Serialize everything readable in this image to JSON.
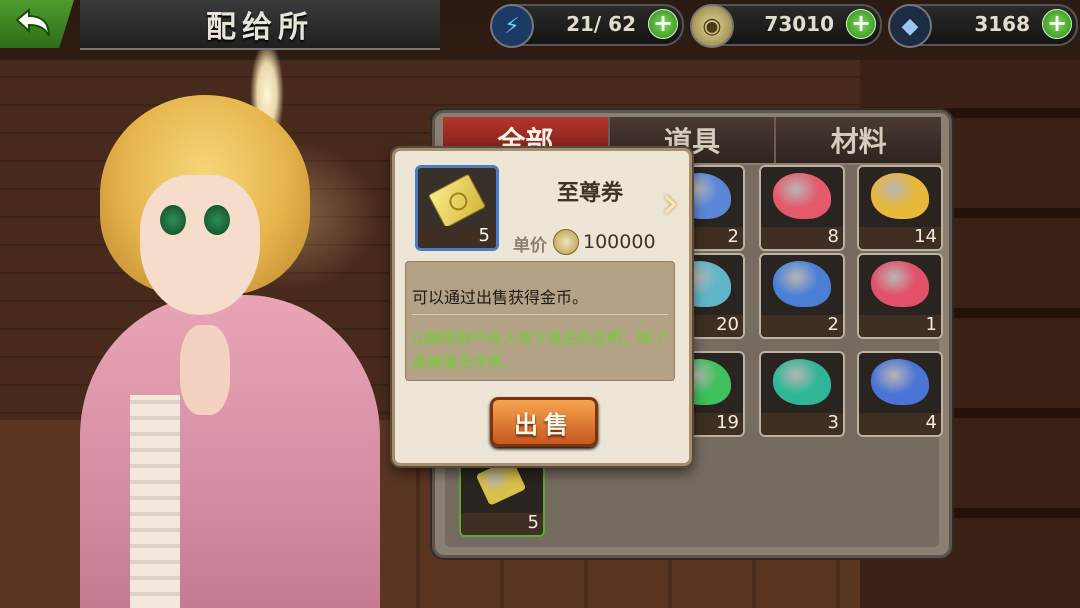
{
  "header": {
    "title": "配给所",
    "stamina": {
      "icon": "lightning-icon",
      "value": "21/ 62"
    },
    "gold": {
      "icon": "coin-icon",
      "value": "73010"
    },
    "gems": {
      "icon": "crystal-icon",
      "value": "3168"
    }
  },
  "inventory": {
    "tabs": [
      {
        "label": "全部",
        "active": true
      },
      {
        "label": "道具",
        "active": false
      },
      {
        "label": "材料",
        "active": false
      }
    ],
    "items": [
      {
        "count": "2",
        "color": "#5c86d8"
      },
      {
        "count": "8",
        "color": "#e45a6c"
      },
      {
        "count": "14",
        "color": "#e8b83a"
      },
      {
        "count": "20",
        "color": "#5fb6c8"
      },
      {
        "count": "2",
        "color": "#4a7fd6"
      },
      {
        "count": "1",
        "color": "#e2506a"
      },
      {
        "count": "19",
        "color": "#3fc05a"
      },
      {
        "count": "3",
        "color": "#2fb696"
      },
      {
        "count": "4",
        "color": "#4c74d6"
      },
      {
        "count": "5",
        "color": "#d9c048"
      }
    ]
  },
  "popup": {
    "item_name": "至尊券",
    "count": "5",
    "price_label": "单价",
    "price": "100000",
    "description": "可以通过出售获得金币。",
    "flavor_text": "山贼将财产存入地下钱庄的证明，除了卖掉毫无作用。",
    "sell_label": "出售"
  }
}
